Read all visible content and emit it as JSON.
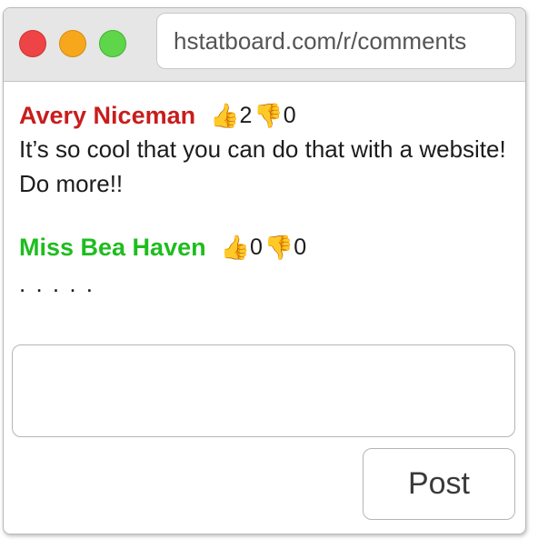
{
  "browser": {
    "url": "hstatboard.com/r/comments",
    "colors": {
      "close": "#ee4446",
      "minimize": "#f6a71c",
      "maximize": "#5fd54a"
    }
  },
  "comments": [
    {
      "author": "Avery Niceman",
      "author_color": "#c81d1d",
      "likes": "2",
      "dislikes": "0",
      "text": "It’s so cool that you can do that with a website! Do more!!"
    },
    {
      "author": "Miss Bea Haven",
      "author_color": "#1ebd1e",
      "likes": "0",
      "dislikes": "0",
      "text": ". . . . ."
    }
  ],
  "icons": {
    "like": "thumbs-up-icon",
    "dislike": "thumbs-down-icon"
  },
  "composer": {
    "input_value": "",
    "post_label": "Post"
  }
}
